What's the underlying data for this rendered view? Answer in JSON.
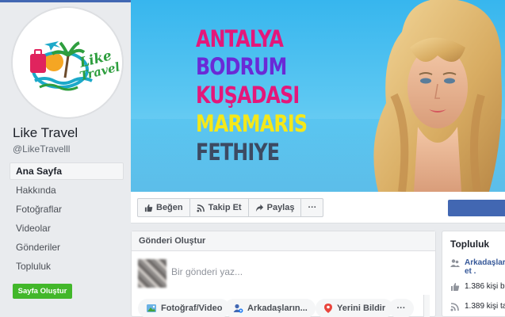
{
  "page": {
    "name": "Like Travel",
    "handle": "@LikeTravelll",
    "logo_text_line1": "Like",
    "logo_text_line2": "Travel"
  },
  "nav": [
    {
      "label": "Ana Sayfa",
      "active": true
    },
    {
      "label": "Hakkında"
    },
    {
      "label": "Fotoğraflar"
    },
    {
      "label": "Videolar"
    },
    {
      "label": "Gönderiler"
    },
    {
      "label": "Topluluk"
    }
  ],
  "create_page_button": "Sayfa Oluştur",
  "cover": {
    "cities": [
      {
        "name": "ANTALYA",
        "color": "#e4177a"
      },
      {
        "name": "BODRUM",
        "color": "#6a2ad6"
      },
      {
        "name": "KUŞADASI",
        "color": "#e4177a"
      },
      {
        "name": "MARMARIS",
        "color": "#f4e81a"
      },
      {
        "name": "FETHIYE",
        "color": "#3c4a62"
      }
    ]
  },
  "actions": {
    "like": "Beğen",
    "follow": "Takip Et",
    "share": "Paylaş",
    "more": "···"
  },
  "composer": {
    "header": "Gönderi Oluştur",
    "placeholder": "Bir gönderi yaz...",
    "photo_video": "Fotoğraf/Video",
    "tag_friends": "Arkadaşların...",
    "checkin": "Yerini Bildir",
    "more": "···"
  },
  "community": {
    "title": "Topluluk",
    "friends_label": "Arkadaşları",
    "friends_label_2": "et .",
    "likes_text": "1.386 kişi b",
    "follows_text": "1.389 kişi ta"
  },
  "colors": {
    "brand_blue": "#4267b2",
    "green": "#42b72a",
    "link": "#365899"
  }
}
